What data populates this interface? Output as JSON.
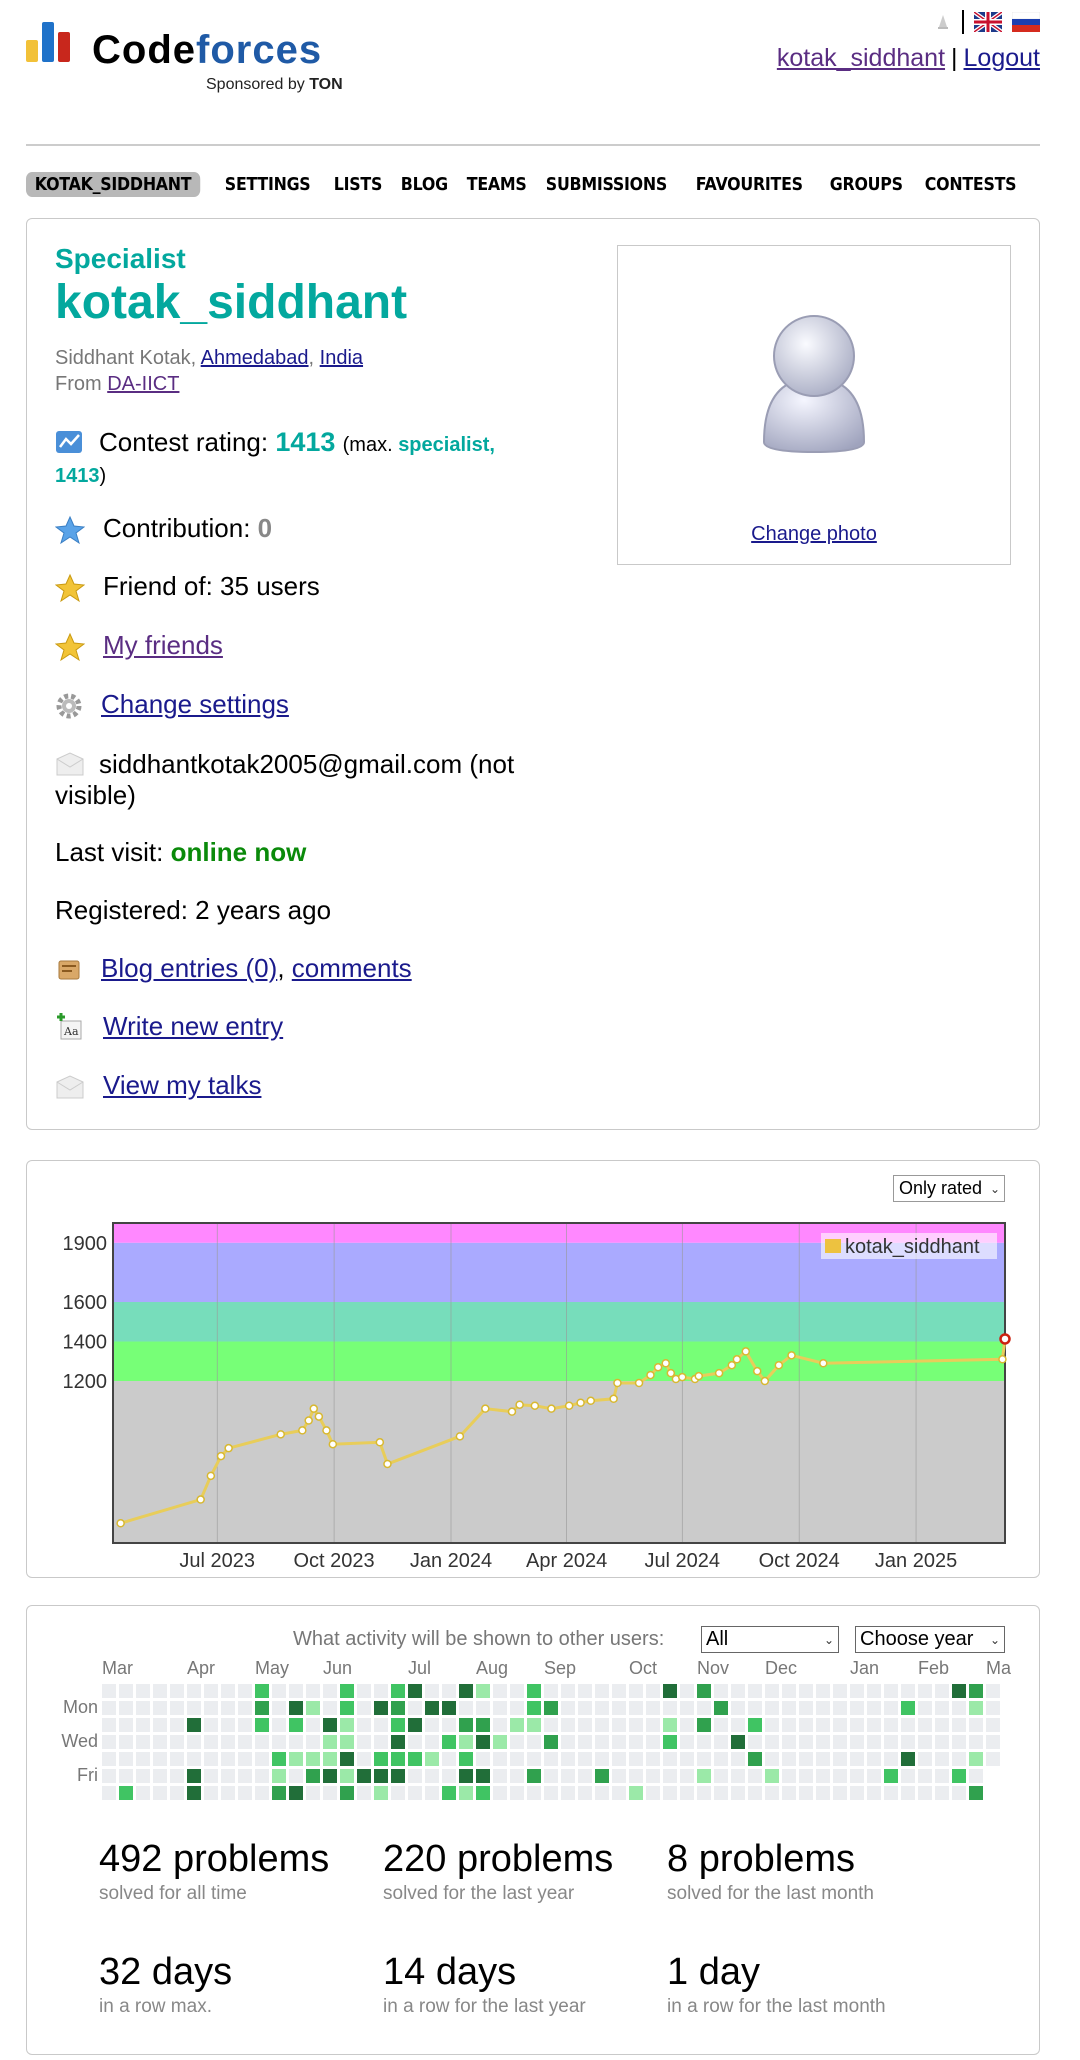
{
  "header": {
    "logo_word_code": "Code",
    "logo_word_forces": "forces",
    "sponsored_prefix": "Sponsored by",
    "sponsored_brand": "TON",
    "username_link": "kotak_siddhant",
    "separator": "|",
    "logout": "Logout"
  },
  "nav": [
    "KOTAK_SIDDHANT",
    "SETTINGS",
    "LISTS",
    "BLOG",
    "TEAMS",
    "SUBMISSIONS",
    "FAVOURITES",
    "GROUPS",
    "CONTESTS"
  ],
  "profile": {
    "rank": "Specialist",
    "handle": "kotak_siddhant",
    "full_name": "Siddhant Kotak, ",
    "city": "Ahmedabad",
    "comma": ", ",
    "country": "India",
    "from_label": "From ",
    "org": "DA-IICT",
    "contest_rating_label": "Contest rating: ",
    "contest_rating": "1413",
    "max_prefix": "(max. ",
    "max_rank": "specialist,",
    "max_rating": "1413",
    "max_suffix": ")",
    "contribution_label": "Contribution: ",
    "contribution": "0",
    "friend_of": "Friend of: 35 users",
    "my_friends": "My friends",
    "change_settings": "Change settings",
    "email": "siddhantkotak2005@gmail.com (not visible)",
    "last_visit_label": "Last visit: ",
    "last_visit": "online now",
    "registered": "Registered: 2 years ago",
    "blog_entries": "Blog entries (0)",
    "blog_comma": ", ",
    "comments": "comments",
    "write_entry": "Write new entry",
    "view_talks": "View my talks",
    "change_photo": "Change photo"
  },
  "chart_data": {
    "type": "line",
    "title": "",
    "xlabel": "",
    "ylabel": "",
    "x_ticks": [
      "Jul 2023",
      "Oct 2023",
      "Jan 2024",
      "Apr 2024",
      "Jul 2024",
      "Oct 2024",
      "Jan 2025"
    ],
    "y_ticks": [
      1200,
      1400,
      1600,
      1900
    ],
    "ylim": [
      380,
      2000
    ],
    "legend": "kotak_siddhant",
    "legend_position": "top-right",
    "grid": true,
    "filter_select": "Only rated",
    "series": [
      {
        "name": "kotak_siddhant",
        "x": [
          "2023-04-16",
          "2023-06-18",
          "2023-06-26",
          "2023-07-04",
          "2023-07-10",
          "2023-08-20",
          "2023-09-06",
          "2023-09-11",
          "2023-09-15",
          "2023-09-19",
          "2023-09-25",
          "2023-09-30",
          "2023-11-06",
          "2023-11-12",
          "2024-01-08",
          "2024-01-28",
          "2024-02-18",
          "2024-02-24",
          "2024-03-07",
          "2024-03-20",
          "2024-04-03",
          "2024-04-12",
          "2024-04-20",
          "2024-05-08",
          "2024-05-11",
          "2024-05-28",
          "2024-06-06",
          "2024-06-12",
          "2024-06-18",
          "2024-06-22",
          "2024-06-26",
          "2024-07-01",
          "2024-07-11",
          "2024-07-14",
          "2024-07-30",
          "2024-08-09",
          "2024-08-13",
          "2024-08-20",
          "2024-08-29",
          "2024-09-04",
          "2024-09-15",
          "2024-09-25",
          "2024-10-20",
          "2025-03-10",
          "2025-03-12"
        ],
        "values": [
          480,
          600,
          720,
          820,
          860,
          930,
          950,
          1000,
          1060,
          1020,
          950,
          880,
          890,
          780,
          920,
          1060,
          1045,
          1080,
          1075,
          1060,
          1075,
          1090,
          1100,
          1110,
          1190,
          1190,
          1230,
          1270,
          1290,
          1240,
          1210,
          1220,
          1210,
          1225,
          1240,
          1280,
          1310,
          1350,
          1250,
          1200,
          1280,
          1330,
          1290,
          1310,
          1413
        ]
      }
    ]
  },
  "activity": {
    "label": "What activity will be shown to other users:",
    "filter": "All",
    "year": "Choose year",
    "months": [
      "Mar",
      "Apr",
      "May",
      "Jun",
      "Jul",
      "Aug",
      "Sep",
      "Oct",
      "Nov",
      "Dec",
      "Jan",
      "Feb",
      "Ma"
    ],
    "day_labels": [
      "Mon",
      "Wed",
      "Fri"
    ],
    "stats": [
      {
        "big": "492 problems",
        "small": "solved for all time"
      },
      {
        "big": "220 problems",
        "small": "solved for the last year"
      },
      {
        "big": "8 problems",
        "small": "solved for the last month"
      },
      {
        "big": "32 days",
        "small": "in a row max."
      },
      {
        "big": "14 days",
        "small": "in a row for the last year"
      },
      {
        "big": "1 day",
        "small": "in a row for the last month"
      }
    ]
  },
  "colors": {
    "teal": "#03a89e",
    "link": "#1a1a8c",
    "visited": "#5a2d82",
    "online": "#0a8a0a"
  }
}
